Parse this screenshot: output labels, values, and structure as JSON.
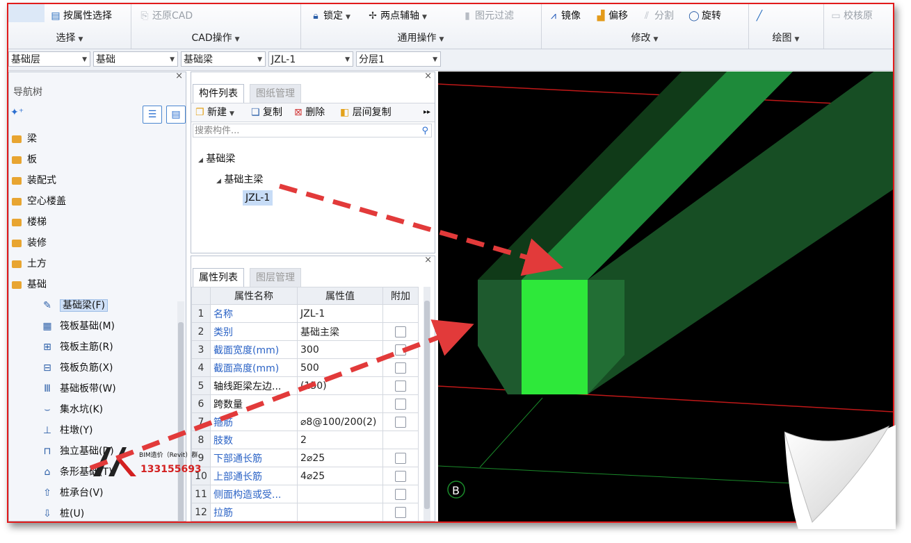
{
  "ribbon": {
    "groups": [
      {
        "label": "选择",
        "tools": [
          {
            "icon": "attribute-select-icon",
            "text": "按属性选择",
            "enabled": true
          }
        ]
      },
      {
        "label": "CAD操作",
        "tools": [
          {
            "icon": "restore-cad-icon",
            "text": "还原CAD",
            "enabled": false
          }
        ]
      },
      {
        "label": "通用操作",
        "tools": [
          {
            "icon": "lock-icon",
            "text": "锁定",
            "enabled": true
          },
          {
            "icon": "two-point-axis-icon",
            "text": "两点辅轴",
            "enabled": true
          },
          {
            "icon": "element-filter-icon",
            "text": "图元过滤",
            "enabled": false
          }
        ]
      },
      {
        "label": "修改",
        "tools": [
          {
            "icon": "mirror-icon",
            "text": "镜像",
            "enabled": true
          },
          {
            "icon": "offset-icon",
            "text": "偏移",
            "enabled": true
          },
          {
            "icon": "split-icon",
            "text": "分割",
            "enabled": false
          },
          {
            "icon": "rotate-icon",
            "text": "旋转",
            "enabled": true
          }
        ]
      },
      {
        "label": "绘图",
        "tools": [
          {
            "icon": "draw-line-icon",
            "text": "",
            "enabled": true
          }
        ]
      },
      {
        "label": "",
        "tools": [
          {
            "icon": "check-icon",
            "text": "校核原",
            "enabled": false
          }
        ]
      }
    ]
  },
  "selectors": [
    "基础层",
    "基础",
    "基础梁",
    "JZL-1",
    "分层1"
  ],
  "nav": {
    "title": "导航树",
    "folders": [
      "梁",
      "板",
      "装配式",
      "空心楼盖",
      "楼梯",
      "装修",
      "土方",
      "基础"
    ],
    "sub_items": [
      {
        "icon": "pencil-icon",
        "label": "基础梁(F)",
        "selected": true
      },
      {
        "icon": "raft-foundation-icon",
        "label": "筏板基础(M)",
        "selected": false
      },
      {
        "icon": "raft-main-rebar-icon",
        "label": "筏板主筋(R)",
        "selected": false
      },
      {
        "icon": "raft-negative-rebar-icon",
        "label": "筏板负筋(X)",
        "selected": false
      },
      {
        "icon": "foundation-strip-icon",
        "label": "基础板带(W)",
        "selected": false
      },
      {
        "icon": "sump-icon",
        "label": "集水坑(K)",
        "selected": false
      },
      {
        "icon": "column-pier-icon",
        "label": "柱墩(Y)",
        "selected": false
      },
      {
        "icon": "isolated-footing-icon",
        "label": "独立基础(D)",
        "selected": false
      },
      {
        "icon": "strip-footing-icon",
        "label": "条形基础(T)",
        "selected": false
      },
      {
        "icon": "pile-cap-icon",
        "label": "桩承台(V)",
        "selected": false
      },
      {
        "icon": "pile-icon",
        "label": "桩(U)",
        "selected": false
      }
    ]
  },
  "components": {
    "tabs": [
      "构件列表",
      "图纸管理"
    ],
    "toolbar": [
      "新建",
      "复制",
      "删除",
      "层间复制"
    ],
    "search_placeholder": "搜索构件...",
    "tree": {
      "root": "基础梁",
      "child": "基础主梁",
      "leaf": "JZL-1"
    }
  },
  "properties": {
    "tabs": [
      "属性列表",
      "图层管理"
    ],
    "headers": [
      "属性名称",
      "属性值",
      "附加"
    ],
    "rows": [
      {
        "n": "1",
        "name": "名称",
        "value": "JZL-1",
        "checkbox": false,
        "blue": true
      },
      {
        "n": "2",
        "name": "类别",
        "value": "基础主梁",
        "checkbox": true,
        "blue": true
      },
      {
        "n": "3",
        "name": "截面宽度(mm)",
        "value": "300",
        "checkbox": true,
        "blue": true
      },
      {
        "n": "4",
        "name": "截面高度(mm)",
        "value": "500",
        "checkbox": true,
        "blue": true
      },
      {
        "n": "5",
        "name": "轴线距梁左边...",
        "value": "(150)",
        "checkbox": true,
        "blue": false
      },
      {
        "n": "6",
        "name": "跨数量",
        "value": "",
        "checkbox": true,
        "blue": false
      },
      {
        "n": "7",
        "name": "箍筋",
        "value": "⌀8@100/200(2)",
        "checkbox": true,
        "blue": true
      },
      {
        "n": "8",
        "name": "肢数",
        "value": "2",
        "checkbox": false,
        "blue": true
      },
      {
        "n": "9",
        "name": "下部通长筋",
        "value": "2⌀25",
        "checkbox": true,
        "blue": true
      },
      {
        "n": "10",
        "name": "上部通长筋",
        "value": "4⌀25",
        "checkbox": true,
        "blue": true
      },
      {
        "n": "11",
        "name": "侧面构造或受...",
        "value": "",
        "checkbox": true,
        "blue": true
      },
      {
        "n": "12",
        "name": "拉筋",
        "value": "",
        "checkbox": true,
        "blue": true
      }
    ]
  },
  "viewport": {
    "axis_label": "B"
  },
  "watermark": {
    "line1": "BIM造价（Revit）群",
    "line2": "133155693"
  }
}
